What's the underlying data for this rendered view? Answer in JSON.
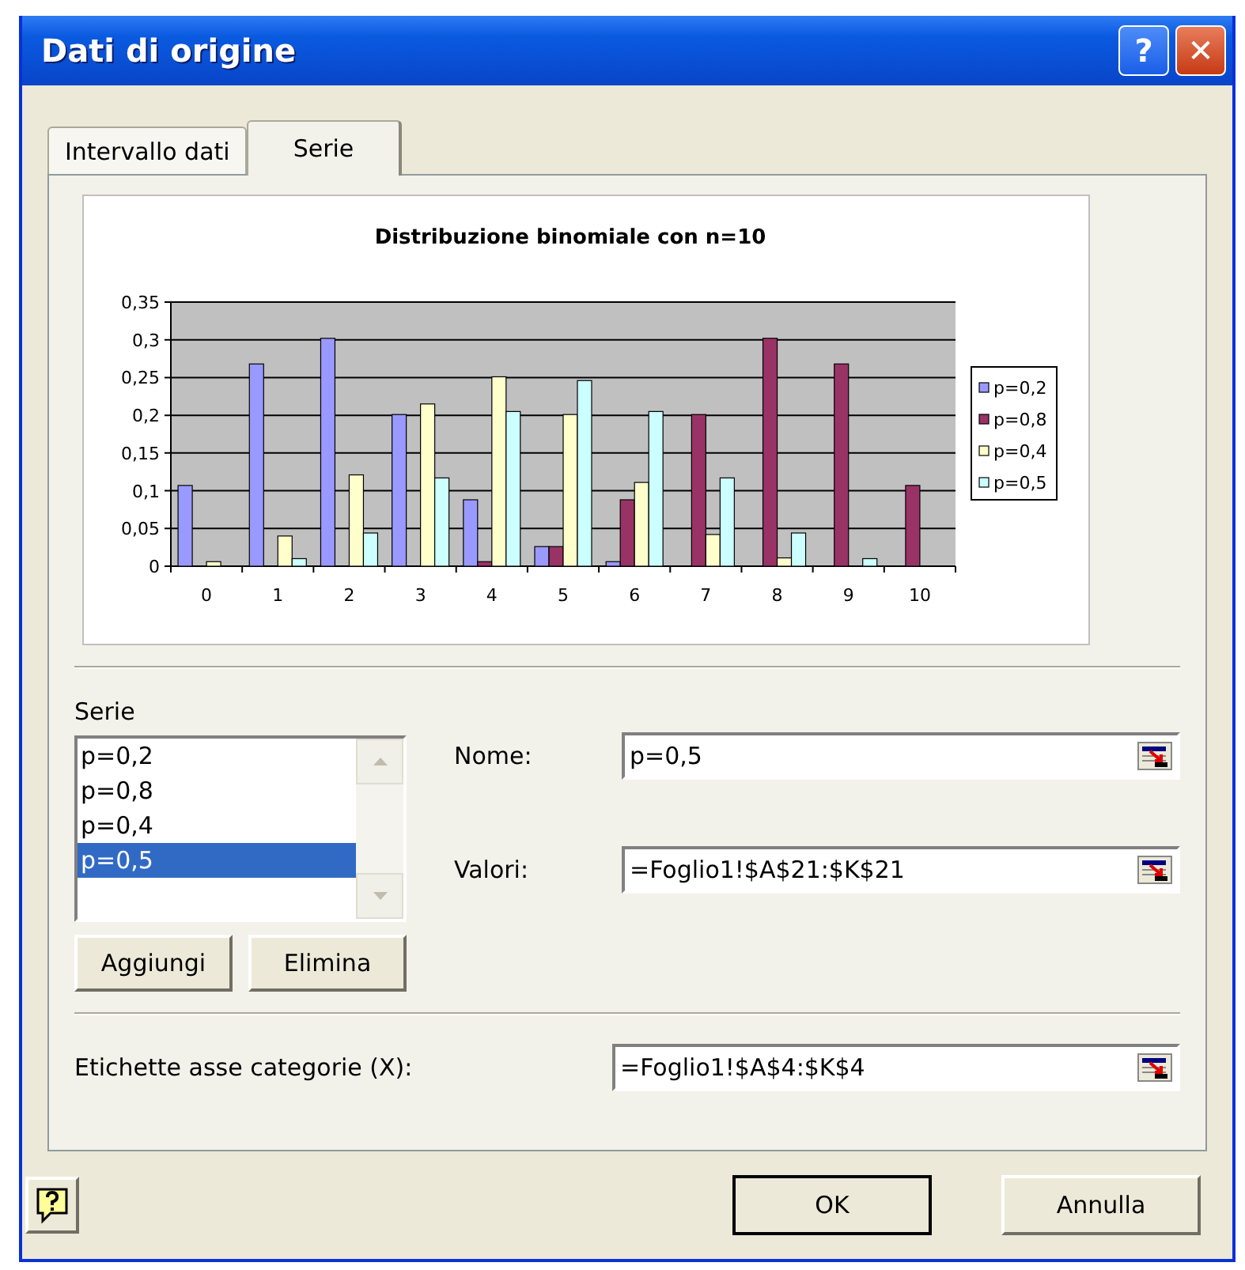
{
  "window": {
    "title": "Dati di origine"
  },
  "title_buttons": [
    {
      "kind": "help",
      "label": "?"
    },
    {
      "kind": "close",
      "label": "✕"
    }
  ],
  "tabs": [
    {
      "label": "Intervallo dati",
      "selected": false
    },
    {
      "label": "Serie",
      "selected": true
    }
  ],
  "chart_data": {
    "type": "bar",
    "title": "Distribuzione binomiale con n=10",
    "categories": [
      "0",
      "1",
      "2",
      "3",
      "4",
      "5",
      "6",
      "7",
      "8",
      "9",
      "10"
    ],
    "ylim": [
      0,
      0.35
    ],
    "grid": true,
    "legend": true,
    "yticks": [
      {
        "value": 0,
        "label": "0"
      },
      {
        "value": 0.05,
        "label": "0,05"
      },
      {
        "value": 0.1,
        "label": "0,1"
      },
      {
        "value": 0.15,
        "label": "0,15"
      },
      {
        "value": 0.2,
        "label": "0,2"
      },
      {
        "value": 0.25,
        "label": "0,25"
      },
      {
        "value": 0.3,
        "label": "0,3"
      },
      {
        "value": 0.35,
        "label": "0,35"
      }
    ],
    "series": [
      {
        "name": "p=0,2",
        "color": "#9999ff",
        "values": [
          0.107,
          0.268,
          0.302,
          0.201,
          0.088,
          0.026,
          0.006,
          0,
          0,
          0,
          0
        ]
      },
      {
        "name": "p=0,8",
        "color": "#993366",
        "values": [
          0,
          0,
          0,
          0,
          0.006,
          0.026,
          0.088,
          0.201,
          0.302,
          0.268,
          0.107
        ]
      },
      {
        "name": "p=0,4",
        "color": "#ffffcc",
        "values": [
          0.006,
          0.04,
          0.121,
          0.215,
          0.251,
          0.201,
          0.111,
          0.042,
          0.011,
          0,
          0
        ]
      },
      {
        "name": "p=0,5",
        "color": "#ccffff",
        "values": [
          0,
          0.01,
          0.044,
          0.117,
          0.205,
          0.246,
          0.205,
          0.117,
          0.044,
          0.01,
          0
        ]
      }
    ]
  },
  "series_list": {
    "label": "Serie",
    "items": [
      {
        "label": "p=0,2",
        "selected": false
      },
      {
        "label": "p=0,8",
        "selected": false
      },
      {
        "label": "p=0,4",
        "selected": false
      },
      {
        "label": "p=0,5",
        "selected": true
      }
    ]
  },
  "list_buttons": [
    "Aggiungi",
    "Elimina"
  ],
  "fields": [
    {
      "label": "Nome:",
      "value": "p=0,5"
    },
    {
      "label": "Valori:",
      "value": "=Foglio1!$A$21:$K$21"
    }
  ],
  "category_field": {
    "label": "Etichette asse categorie (X):",
    "value": "=Foglio1!$A$4:$K$4"
  },
  "buttons": [
    "OK",
    "Annulla"
  ]
}
